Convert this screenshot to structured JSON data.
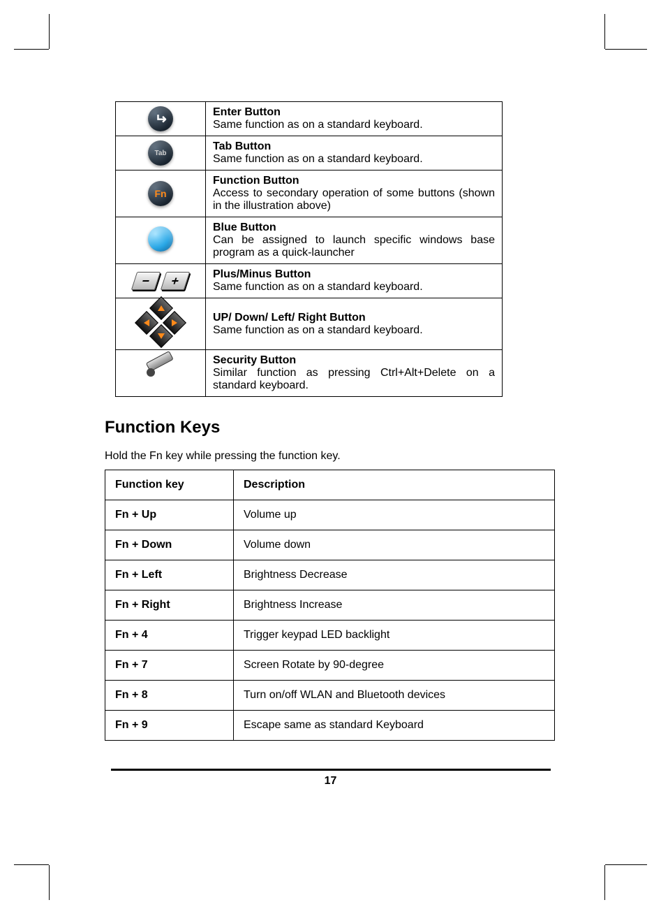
{
  "buttons_table": {
    "rows": [
      {
        "icon": "enter",
        "title": "Enter Button",
        "desc": "Same function as on a standard keyboard."
      },
      {
        "icon": "tab",
        "title": "Tab Button",
        "desc": "Same function as on a standard keyboard."
      },
      {
        "icon": "fn",
        "title": "Function Button",
        "desc": "Access to secondary operation of some buttons (shown in the illustration above)"
      },
      {
        "icon": "blue",
        "title": "Blue Button",
        "desc": "Can be assigned to launch specific windows base program as a quick-launcher"
      },
      {
        "icon": "plusminus",
        "title": "Plus/Minus Button",
        "desc": "Same function as on a standard keyboard."
      },
      {
        "icon": "dpad",
        "title": "UP/ Down/ Left/ Right Button",
        "desc": "Same function as on a standard keyboard."
      },
      {
        "icon": "security",
        "title": "Security Button",
        "desc": "Similar function as pressing Ctrl+Alt+Delete on a standard keyboard."
      }
    ]
  },
  "section": {
    "heading": "Function Keys",
    "intro": "Hold the Fn key while pressing the function key."
  },
  "fn_table": {
    "header": {
      "col1": "Function key",
      "col2": "Description"
    },
    "rows": [
      {
        "key": "Fn + Up",
        "desc": "Volume up"
      },
      {
        "key": "Fn + Down",
        "desc": "Volume down"
      },
      {
        "key": "Fn + Left",
        "desc": "Brightness Decrease"
      },
      {
        "key": "Fn + Right",
        "desc": "Brightness Increase"
      },
      {
        "key": "Fn + 4",
        "desc": "Trigger keypad LED backlight"
      },
      {
        "key": "Fn + 7",
        "desc": "Screen Rotate by 90-degree"
      },
      {
        "key": "Fn + 8",
        "desc": "Turn on/off WLAN and Bluetooth devices"
      },
      {
        "key": "Fn + 9",
        "desc": "Escape same as standard Keyboard"
      }
    ]
  },
  "icon_text": {
    "tab": "Tab",
    "fn": "Fn",
    "minus": "−",
    "plus": "+"
  },
  "page_number": "17"
}
